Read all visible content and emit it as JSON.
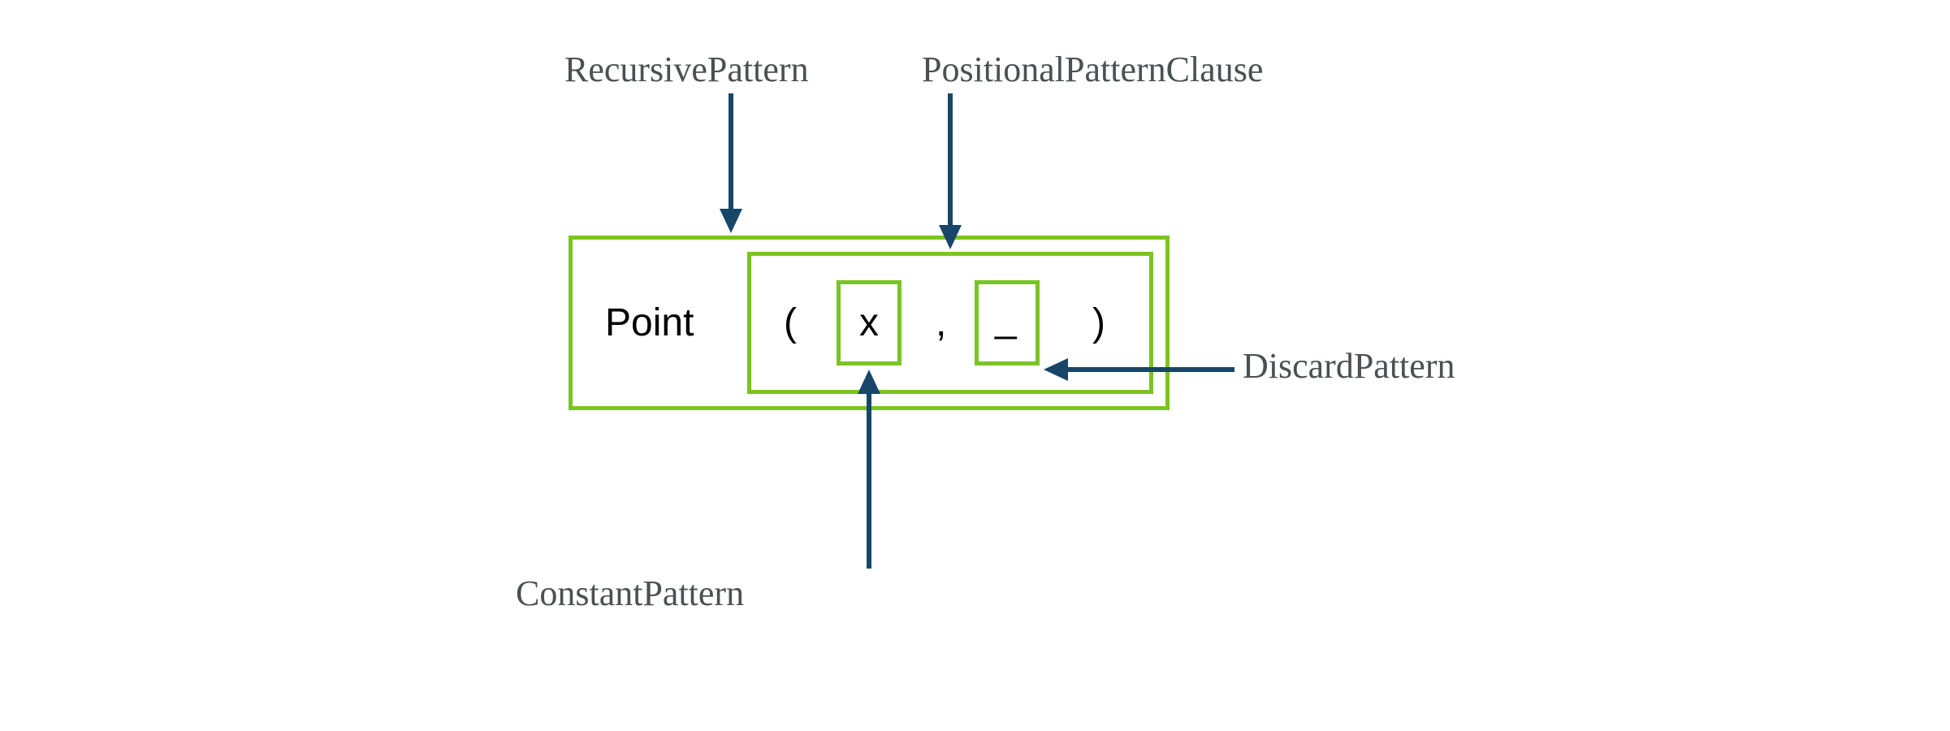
{
  "labels": {
    "recursive_pattern": "RecursivePattern",
    "positional_pattern_clause": "PositionalPatternClause",
    "discard_pattern": "DiscardPattern",
    "constant_pattern": "ConstantPattern"
  },
  "code": {
    "type_name": "Point",
    "open_paren": "(",
    "arg1": "x",
    "comma": ",",
    "arg2": "_",
    "close_paren": ")"
  },
  "colors": {
    "box_border": "#7bc421",
    "arrow": "#184669",
    "label_text": "#4a5153",
    "code_text": "#000000"
  }
}
